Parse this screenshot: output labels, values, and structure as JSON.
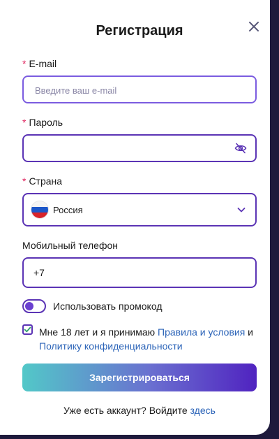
{
  "modal": {
    "title": "Регистрация"
  },
  "email": {
    "required_mark": "*",
    "label": "E-mail",
    "placeholder": "Введите ваш e-mail"
  },
  "password": {
    "required_mark": "*",
    "label": "Пароль",
    "value": ""
  },
  "country": {
    "required_mark": "*",
    "label": "Страна",
    "selected": "Россия"
  },
  "phone": {
    "label": "Мобильный телефон",
    "value": "+7"
  },
  "promo": {
    "label": "Использовать промокод"
  },
  "terms": {
    "prefix": "Мне 18 лет и я принимаю ",
    "rules_link": "Правила и условия",
    "middle": " и ",
    "privacy_link": "Политику конфиденциальности"
  },
  "submit": {
    "label": "Зарегистрироваться"
  },
  "footer": {
    "text": "Уже есть аккаунт? Войдите ",
    "link": "здесь"
  },
  "colors": {
    "accent": "#5b34b5",
    "link": "#2c64b8",
    "required": "#e0245e",
    "button_gradient_start": "#52c8c8",
    "button_gradient_end": "#5023c0"
  },
  "icons": {
    "close": "close-icon",
    "password_toggle": "eye-off-icon",
    "dropdown": "chevron-down-icon",
    "checkbox": "checkmark-icon",
    "flag": "russia-flag-icon"
  }
}
